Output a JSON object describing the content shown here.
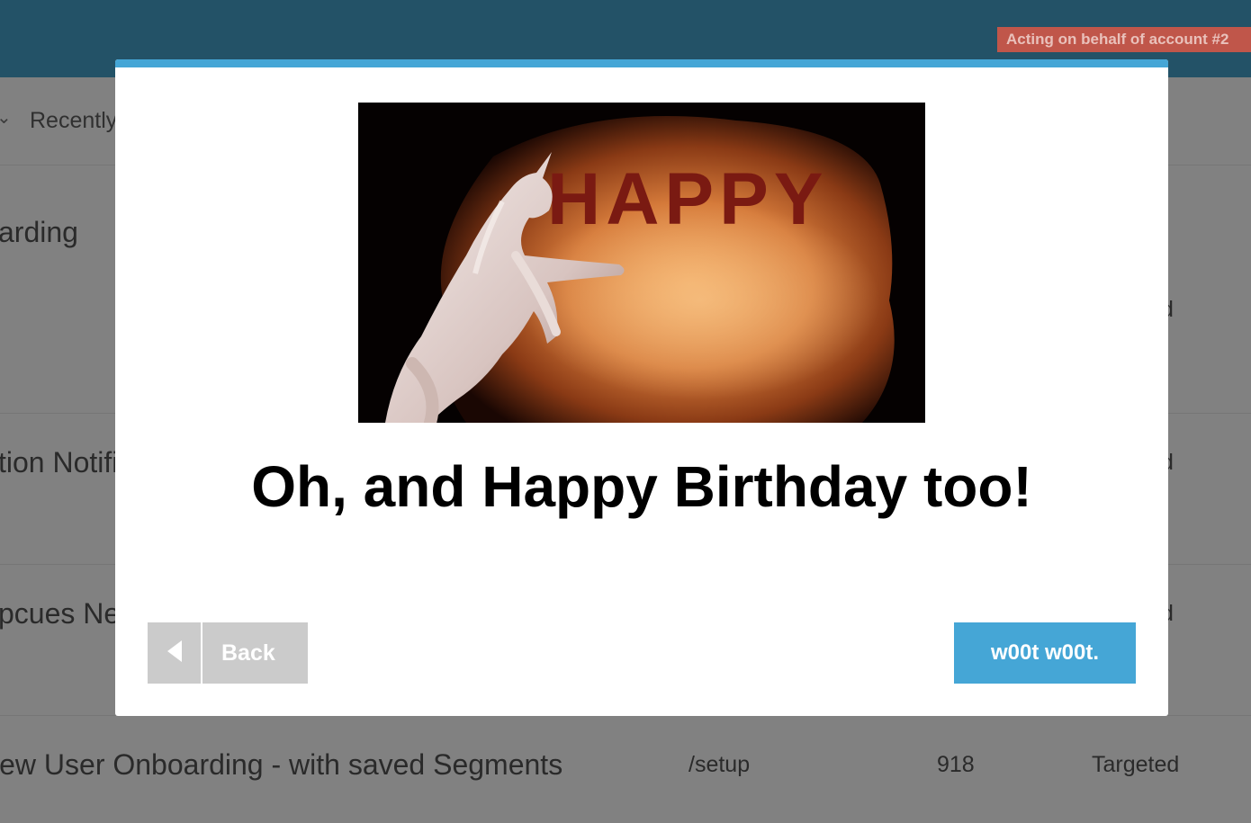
{
  "header": {
    "acting_badge": "Acting on behalf of account #2"
  },
  "filter": {
    "label": "Recently"
  },
  "rows": [
    {
      "name": "arding",
      "status": "d"
    },
    {
      "name": "tion Notifi",
      "status": "d"
    },
    {
      "name": "pcues Ne",
      "status": "d"
    },
    {
      "name": "lew User Onboarding - with saved Segments",
      "url": "/setup",
      "count": "918",
      "status": "Targeted"
    }
  ],
  "modal": {
    "image_text": "HAPPY",
    "heading": "Oh, and Happy Birthday too!",
    "back_label": "Back",
    "primary_label": "w00t w00t."
  },
  "colors": {
    "accent": "#45a6d6",
    "topbar": "#235267",
    "badge": "#c0564a",
    "back_button": "#cbcbcb"
  }
}
